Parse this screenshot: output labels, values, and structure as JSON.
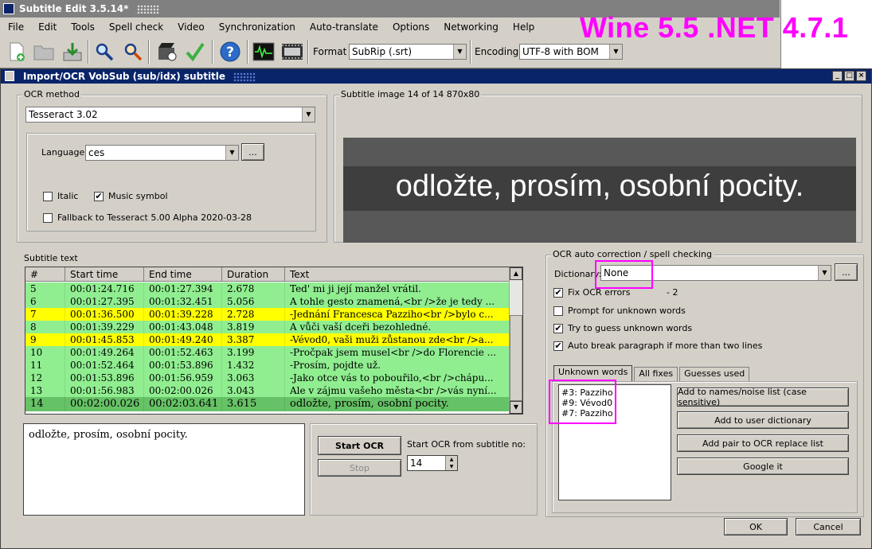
{
  "main": {
    "title": "Subtitle Edit 3.5.14*",
    "menu": [
      "File",
      "Edit",
      "Tools",
      "Spell check",
      "Video",
      "Synchronization",
      "Auto-translate",
      "Options",
      "Networking",
      "Help"
    ],
    "format_label": "Format",
    "format_value": "SubRip (.srt)",
    "encoding_label": "Encoding",
    "encoding_value": "UTF-8 with BOM",
    "watermark": "Wine 5.5 .NET 4.7.1",
    "toolbar_icons": [
      "new-file-icon",
      "open-folder-icon",
      "save-download-icon",
      "find-icon",
      "replace-icon",
      "visual-sync-icon",
      "spell-check-icon",
      "help-icon",
      "waveform-icon",
      "video-icon"
    ]
  },
  "dialog": {
    "title": "Import/OCR VobSub (sub/idx) subtitle",
    "ocr_method": {
      "label": "OCR method",
      "engine": "Tesseract 3.02",
      "language_label": "Language",
      "language": "ces",
      "browse": "...",
      "italic_label": "Italic",
      "italic_checked": false,
      "music_label": "Music symbol",
      "music_checked": true,
      "fallback_label": "Fallback to Tesseract 5.00 Alpha 2020-03-28",
      "fallback_checked": false
    },
    "subtitle_image": {
      "label": "Subtitle image 14 of 14   870x80",
      "text": "odložte, prosím, osobní pocity."
    },
    "subtitle_text": {
      "label": "Subtitle text",
      "columns": [
        "#",
        "Start time",
        "End time",
        "Duration",
        "Text"
      ],
      "rows": [
        {
          "n": "5",
          "start": "00:01:24.716",
          "end": "00:01:27.394",
          "dur": "2.678",
          "text": "Ted' mi ji její manžel vrátil.",
          "color": "#90ee90"
        },
        {
          "n": "6",
          "start": "00:01:27.395",
          "end": "00:01:32.451",
          "dur": "5.056",
          "text": "A tohle gesto znamená,<br />že je tedy ...",
          "color": "#90ee90"
        },
        {
          "n": "7",
          "start": "00:01:36.500",
          "end": "00:01:39.228",
          "dur": "2.728",
          "text": "-Jednání Francesca Pazziho<br />bylo c...",
          "color": "#ffff00"
        },
        {
          "n": "8",
          "start": "00:01:39.229",
          "end": "00:01:43.048",
          "dur": "3.819",
          "text": "A vůči vaší dceři bezohledné.",
          "color": "#90ee90"
        },
        {
          "n": "9",
          "start": "00:01:45.853",
          "end": "00:01:49.240",
          "dur": "3.387",
          "text": "-Vévod0, vaši muži zůstanou zde<br />a...",
          "color": "#ffff00"
        },
        {
          "n": "10",
          "start": "00:01:49.264",
          "end": "00:01:52.463",
          "dur": "3.199",
          "text": "-Pročpak jsem musel<br />do Florencie ...",
          "color": "#90ee90"
        },
        {
          "n": "11",
          "start": "00:01:52.464",
          "end": "00:01:53.896",
          "dur": "1.432",
          "text": "-Prosím, pojdte už.",
          "color": "#90ee90"
        },
        {
          "n": "12",
          "start": "00:01:53.896",
          "end": "00:01:56.959",
          "dur": "3.063",
          "text": "-Jako otce vás to pobouřilo,<br />chápu...",
          "color": "#90ee90"
        },
        {
          "n": "13",
          "start": "00:01:56.983",
          "end": "00:02:00.026",
          "dur": "3.043",
          "text": "Ale v zájmu vašeho města<br />vás nyní...",
          "color": "#90ee90"
        },
        {
          "n": "14",
          "start": "00:02:00.026",
          "end": "00:02:03.641",
          "dur": "3.615",
          "text": "odložte, prosím, osobní pocity.",
          "color": "#66c266"
        }
      ],
      "current_text": "odložte, prosím, osobní pocity."
    },
    "controls": {
      "start_ocr": "Start OCR",
      "stop": "Stop",
      "start_from_label": "Start OCR from subtitle no:",
      "start_from_value": "14"
    },
    "autocorrect": {
      "label": "OCR auto correction / spell checking",
      "dictionary_label": "Dictionary:",
      "dictionary_value": "None",
      "browse": "...",
      "fix_label": "Fix OCR errors",
      "fix_checked": true,
      "fix_count": "- 2",
      "prompt_label": "Prompt for unknown words",
      "prompt_checked": false,
      "guess_label": "Try to guess unknown words",
      "guess_checked": true,
      "autobreak_label": "Auto break paragraph if more than two lines",
      "autobreak_checked": true,
      "tabs": [
        "Unknown words",
        "All fixes",
        "Guesses used"
      ],
      "unknown_words": [
        "#3: Pazziho",
        "#9: Vévod0",
        "#7: Pazziho"
      ],
      "buttons": [
        "Add to names/noise list (case sensitive)",
        "Add to user dictionary",
        "Add pair to OCR replace list",
        "Google it"
      ]
    },
    "ok": "OK",
    "cancel": "Cancel"
  }
}
